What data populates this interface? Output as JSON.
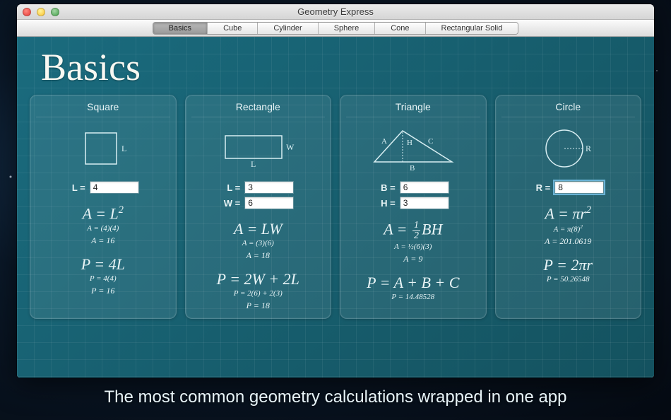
{
  "window": {
    "title": "Geometry Express"
  },
  "tabs": [
    "Basics",
    "Cube",
    "Cylinder",
    "Sphere",
    "Cone",
    "Rectangular Solid"
  ],
  "active_tab": "Basics",
  "page_title": "Basics",
  "cards": {
    "square": {
      "title": "Square",
      "shape_label": "L",
      "inputs": [
        {
          "label": "L =",
          "value": "4"
        }
      ],
      "area_formula": "A = L²",
      "area_sub": "A = (4)(4)",
      "area_result": "A = 16",
      "perim_formula": "P = 4L",
      "perim_sub": "P = 4(4)",
      "perim_result": "P = 16"
    },
    "rectangle": {
      "title": "Rectangle",
      "shape_labels": {
        "w": "W",
        "l": "L"
      },
      "inputs": [
        {
          "label": "L =",
          "value": "3"
        },
        {
          "label": "W =",
          "value": "6"
        }
      ],
      "area_formula": "A = LW",
      "area_sub": "A = (3)(6)",
      "area_result": "A = 18",
      "perim_formula": "P = 2W + 2L",
      "perim_sub": "P = 2(6) + 2(3)",
      "perim_result": "P = 18"
    },
    "triangle": {
      "title": "Triangle",
      "shape_labels": {
        "a": "A",
        "b": "B",
        "c": "C",
        "h": "H"
      },
      "inputs": [
        {
          "label": "B =",
          "value": "6"
        },
        {
          "label": "H =",
          "value": "3"
        }
      ],
      "area_formula_prefix": "A = ",
      "area_formula_suffix": "BH",
      "area_frac_n": "1",
      "area_frac_d": "2",
      "area_sub": "A = ½(6)(3)",
      "area_result": "A = 9",
      "perim_formula": "P = A + B + C",
      "perim_sub": "P = 14.48528",
      "perim_result": ""
    },
    "circle": {
      "title": "Circle",
      "shape_label": "R",
      "inputs": [
        {
          "label": "R =",
          "value": "8"
        }
      ],
      "area_formula": "A = πr²",
      "area_sub": "A = π(8)²",
      "area_result": "A = 201.0619",
      "perim_formula": "P = 2πr",
      "perim_sub": "P = 50.26548",
      "perim_result": ""
    }
  },
  "tagline": "The most common geometry calculations wrapped in one app"
}
